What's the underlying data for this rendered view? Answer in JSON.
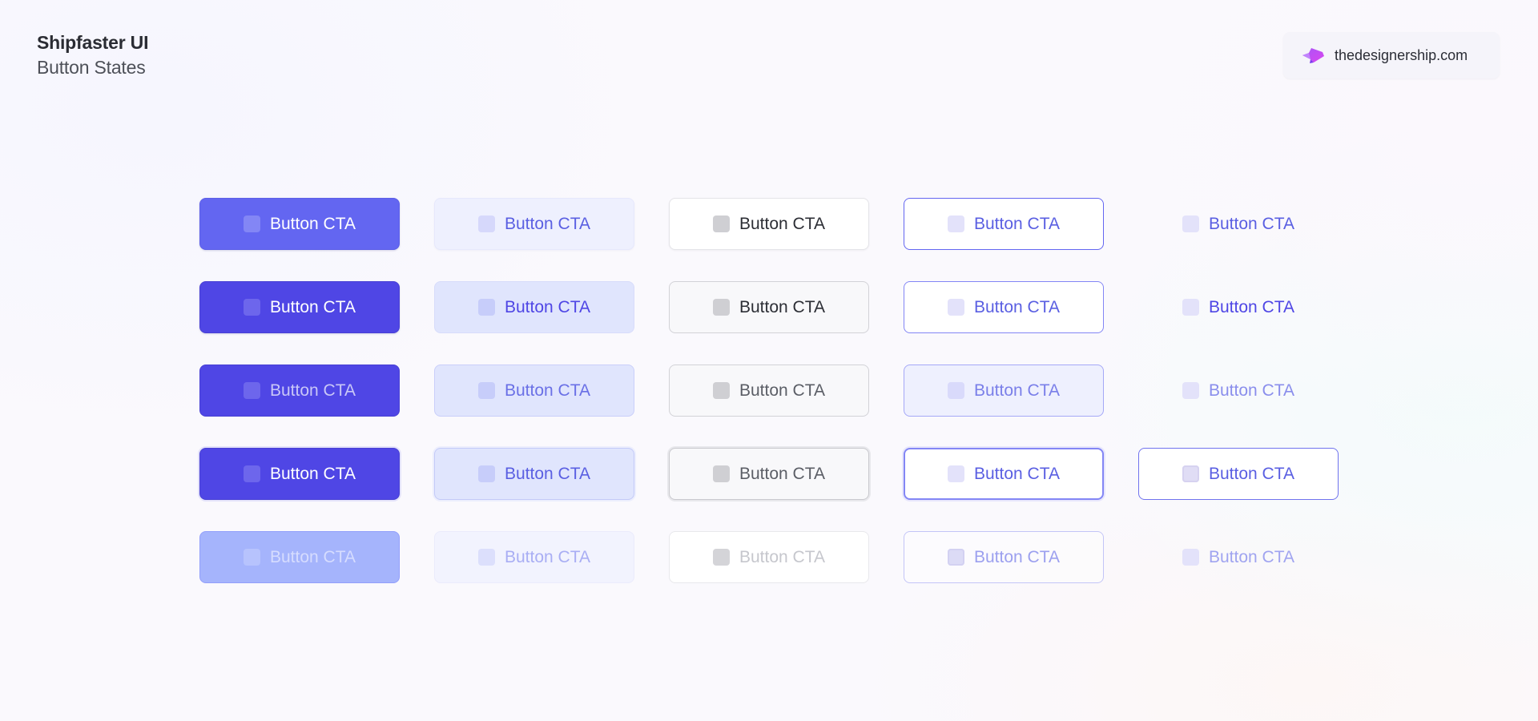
{
  "header": {
    "title": "Shipfaster UI",
    "subtitle": "Button States"
  },
  "badge": {
    "text": "thedesignership.com",
    "icon": "designership-logo-icon",
    "colors": [
      "#8b5cf6",
      "#d946ef"
    ]
  },
  "colors": {
    "primary": "#6366f1",
    "primary_dark": "#4f46e5",
    "primary_disabled": "#a5b4fc",
    "secondary_bg": "#eef0fe",
    "neutral_text": "#2c2e35"
  },
  "variants": [
    "primary",
    "secondary",
    "neutral",
    "outline",
    "ghost"
  ],
  "states": [
    "default",
    "hover",
    "pressed",
    "focus",
    "disabled"
  ],
  "button_label": "Button CTA"
}
